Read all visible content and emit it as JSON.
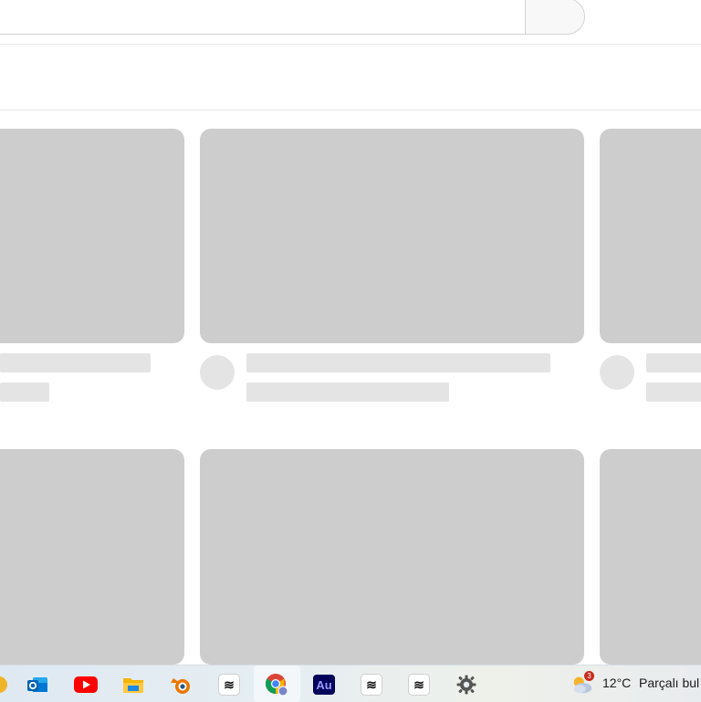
{
  "search": {
    "placeholder": ""
  },
  "taskbar": {
    "apps": [
      {
        "name": "outlook-icon"
      },
      {
        "name": "youtube-icon"
      },
      {
        "name": "file-explorer-icon"
      },
      {
        "name": "blender-icon"
      },
      {
        "name": "capcut-icon"
      },
      {
        "name": "chrome-icon"
      },
      {
        "name": "audition-icon",
        "label": "Au"
      },
      {
        "name": "capcut-icon"
      },
      {
        "name": "capcut-icon"
      },
      {
        "name": "settings-icon"
      }
    ],
    "weather": {
      "badge": "3",
      "temperature": "12°C",
      "condition": "Parçalı bul"
    }
  },
  "colors": {
    "skeleton_thumb": "#cdcdcd",
    "skeleton_line": "#e4e4e4",
    "youtube_red": "#ff0000",
    "chrome_blue": "#4285f4",
    "audition_bg": "#00005b",
    "audition_text": "#9999ff"
  }
}
